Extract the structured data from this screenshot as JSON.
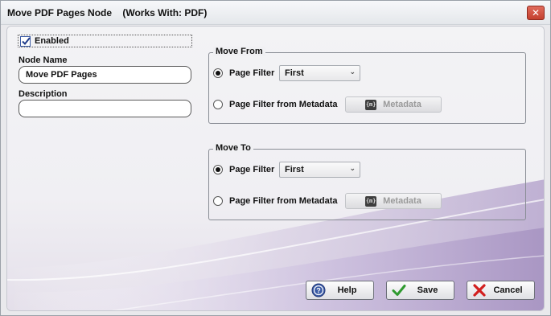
{
  "window": {
    "title": "Move PDF Pages Node    (Works With: PDF)",
    "close_glyph": "✕"
  },
  "general": {
    "enabled_label": "Enabled",
    "enabled_checked": true,
    "node_name_label": "Node Name",
    "node_name_value": "Move PDF Pages",
    "description_label": "Description",
    "description_value": ""
  },
  "move_from": {
    "group_title": "Move From",
    "page_filter_label": "Page Filter",
    "page_filter_selected": true,
    "page_filter_value": "First",
    "metadata_label": "Page Filter from Metadata",
    "metadata_selected": false,
    "metadata_button": "Metadata",
    "metadata_icon": "{m}"
  },
  "move_to": {
    "group_title": "Move To",
    "page_filter_label": "Page Filter",
    "page_filter_selected": true,
    "page_filter_value": "First",
    "metadata_label": "Page Filter from Metadata",
    "metadata_selected": false,
    "metadata_button": "Metadata",
    "metadata_icon": "{m}"
  },
  "buttons": {
    "help": "Help",
    "save": "Save",
    "cancel": "Cancel"
  },
  "icons": {
    "help": "help-icon",
    "save": "checkmark-icon",
    "cancel": "x-icon",
    "close": "close-icon",
    "combo": "chevron-down-icon"
  },
  "colors": {
    "accent_blue": "#3b5ba5",
    "save_green": "#2f9a2f",
    "cancel_red": "#d21f1f",
    "close_red": "#c4402f",
    "wave_purple": "#c8bcd8"
  }
}
